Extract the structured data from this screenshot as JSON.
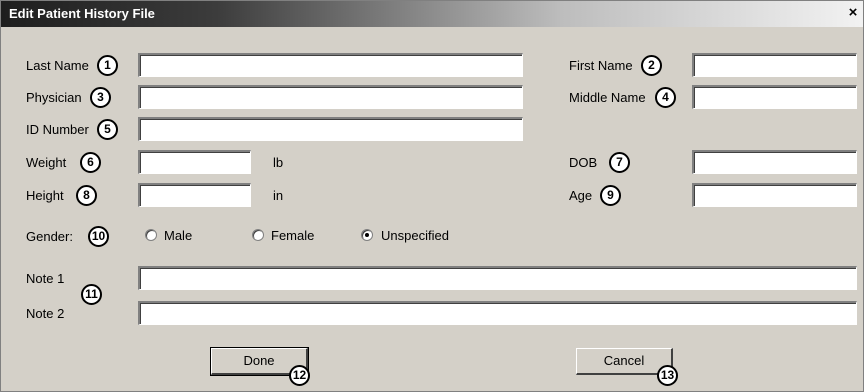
{
  "window": {
    "title": "Edit Patient History File",
    "close_glyph": "×"
  },
  "fields": {
    "last_name": {
      "label": "Last Name",
      "badge": "1",
      "value": ""
    },
    "first_name": {
      "label": "First Name",
      "badge": "2",
      "value": ""
    },
    "physician": {
      "label": "Physician",
      "badge": "3",
      "value": ""
    },
    "middle_name": {
      "label": "Middle Name",
      "badge": "4",
      "value": ""
    },
    "id_number": {
      "label": "ID Number",
      "badge": "5",
      "value": ""
    },
    "weight": {
      "label": "Weight",
      "badge": "6",
      "value": "",
      "unit": "lb"
    },
    "dob": {
      "label": "DOB",
      "badge": "7",
      "value": ""
    },
    "height": {
      "label": "Height",
      "badge": "8",
      "value": "",
      "unit": "in"
    },
    "age": {
      "label": "Age",
      "badge": "9",
      "value": ""
    }
  },
  "gender": {
    "label": "Gender:",
    "badge": "10",
    "options": [
      {
        "label": "Male",
        "checked": false
      },
      {
        "label": "Female",
        "checked": false
      },
      {
        "label": "Unspecified",
        "checked": true
      }
    ]
  },
  "notes": {
    "badge": "11",
    "note1": {
      "label": "Note 1",
      "value": ""
    },
    "note2": {
      "label": "Note 2",
      "value": ""
    }
  },
  "buttons": {
    "done": {
      "label": "Done",
      "badge": "12"
    },
    "cancel": {
      "label": "Cancel",
      "badge": "13"
    }
  }
}
